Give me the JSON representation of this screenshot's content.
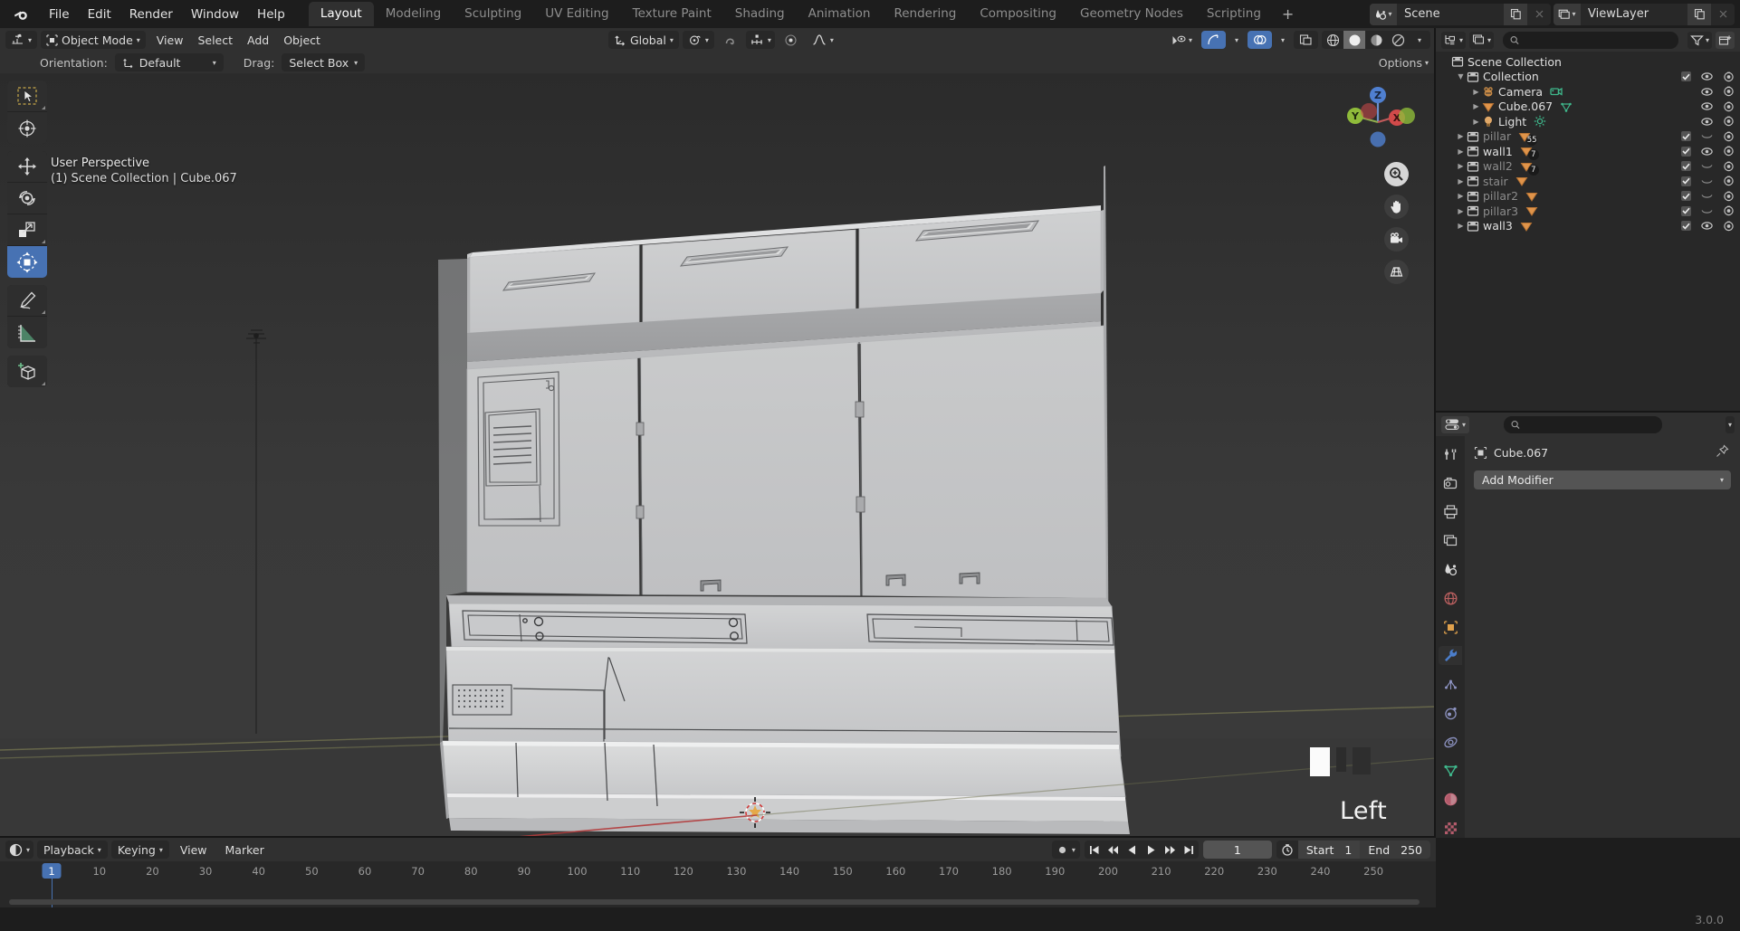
{
  "app": {
    "name": "Blender",
    "version": "3.0.0"
  },
  "topbar": {
    "menus": [
      "File",
      "Edit",
      "Render",
      "Window",
      "Help"
    ],
    "workspaces": [
      {
        "label": "Layout",
        "active": true
      },
      {
        "label": "Modeling",
        "active": false
      },
      {
        "label": "Sculpting",
        "active": false
      },
      {
        "label": "UV Editing",
        "active": false
      },
      {
        "label": "Texture Paint",
        "active": false
      },
      {
        "label": "Shading",
        "active": false
      },
      {
        "label": "Animation",
        "active": false
      },
      {
        "label": "Rendering",
        "active": false
      },
      {
        "label": "Compositing",
        "active": false
      },
      {
        "label": "Geometry Nodes",
        "active": false
      },
      {
        "label": "Scripting",
        "active": false
      }
    ],
    "add_workspace_label": "+",
    "scene_name": "Scene",
    "view_layer_name": "ViewLayer"
  },
  "viewport_header": {
    "mode": "Object Mode",
    "menus": [
      "View",
      "Select",
      "Add",
      "Object"
    ],
    "transform_orientation": "Global",
    "shading_modes": [
      "wireframe",
      "solid",
      "material-preview",
      "rendered"
    ],
    "active_shading_mode": "solid"
  },
  "tool_settings": {
    "orientation_label": "Orientation:",
    "orientation_value": "Default",
    "drag_label": "Drag:",
    "drag_value": "Select Box"
  },
  "viewport": {
    "perspective_text": "User Perspective",
    "context_text": "(1) Scene Collection | Cube.067",
    "view_label": "Left",
    "options_label": "Options",
    "tools": [
      {
        "name": "select-box-tool",
        "active": false
      },
      {
        "name": "cursor-tool",
        "active": false
      },
      {
        "name": "move-tool",
        "active": false
      },
      {
        "name": "rotate-tool",
        "active": false
      },
      {
        "name": "scale-tool",
        "active": false
      },
      {
        "name": "transform-tool",
        "active": true
      },
      {
        "name": "annotate-tool",
        "active": false
      },
      {
        "name": "measure-tool",
        "active": false
      },
      {
        "name": "add-cube-tool",
        "active": false
      }
    ],
    "gizmo_axes": [
      "Z",
      "Y",
      "X"
    ],
    "nav_buttons": [
      "zoom-icon",
      "pan-icon",
      "camera-icon",
      "ortho-grid-icon"
    ],
    "swatch_colors": [
      "#fbfbfb",
      "#2c2c2c",
      "#2e2e2e"
    ]
  },
  "outliner": {
    "search_placeholder": "",
    "rows": [
      {
        "label": "Scene Collection",
        "icon": "collection-icon",
        "indent": 0,
        "dim": false,
        "expander": "",
        "checkbox": false,
        "eye": false,
        "camera": false
      },
      {
        "label": "Collection",
        "icon": "collection-icon",
        "indent": 1,
        "dim": false,
        "expander": "down",
        "checkbox": true,
        "eye": true,
        "camera": true
      },
      {
        "label": "Camera",
        "icon": "camera-obj-icon",
        "indent": 2,
        "dim": false,
        "expander": "right",
        "checkbox": false,
        "eye": true,
        "camera": true,
        "data_icon": "camera-data-icon",
        "badge": ""
      },
      {
        "label": "Cube.067",
        "icon": "mesh-obj-icon",
        "indent": 2,
        "dim": false,
        "expander": "right",
        "checkbox": false,
        "eye": true,
        "camera": true,
        "data_icon": "mesh-data-icon",
        "badge": ""
      },
      {
        "label": "Light",
        "icon": "light-obj-icon",
        "indent": 2,
        "dim": false,
        "expander": "right",
        "checkbox": false,
        "eye": true,
        "camera": true,
        "data_icon": "light-data-icon",
        "badge": ""
      },
      {
        "label": "pillar",
        "icon": "collection-icon",
        "indent": 1,
        "dim": true,
        "expander": "right",
        "checkbox": true,
        "eye": false,
        "camera": true,
        "data_icon": "mesh-obj-icon",
        "badge": "55"
      },
      {
        "label": "wall1",
        "icon": "collection-icon",
        "indent": 1,
        "dim": false,
        "expander": "right",
        "checkbox": true,
        "eye": true,
        "camera": true,
        "data_icon": "mesh-obj-icon",
        "badge": "7"
      },
      {
        "label": "wall2",
        "icon": "collection-icon",
        "indent": 1,
        "dim": true,
        "expander": "right",
        "checkbox": true,
        "eye": false,
        "camera": true,
        "data_icon": "mesh-obj-icon",
        "badge": "7"
      },
      {
        "label": "stair",
        "icon": "collection-icon",
        "indent": 1,
        "dim": true,
        "expander": "right",
        "checkbox": true,
        "eye": false,
        "camera": true,
        "data_icon": "mesh-obj-icon",
        "badge": ""
      },
      {
        "label": "pillar2",
        "icon": "collection-icon",
        "indent": 1,
        "dim": true,
        "expander": "right",
        "checkbox": true,
        "eye": false,
        "camera": true,
        "data_icon": "mesh-obj-icon",
        "badge": ""
      },
      {
        "label": "pillar3",
        "icon": "collection-icon",
        "indent": 1,
        "dim": true,
        "expander": "right",
        "checkbox": true,
        "eye": false,
        "camera": true,
        "data_icon": "mesh-obj-icon",
        "badge": ""
      },
      {
        "label": "wall3",
        "icon": "collection-icon",
        "indent": 1,
        "dim": false,
        "expander": "right",
        "checkbox": true,
        "eye": true,
        "camera": true,
        "data_icon": "mesh-obj-icon",
        "badge": ""
      }
    ]
  },
  "properties": {
    "search_placeholder": "",
    "object_name": "Cube.067",
    "add_modifier_label": "Add Modifier",
    "tabs": [
      {
        "name": "tool-tab",
        "active": false
      },
      {
        "name": "render-tab",
        "active": false
      },
      {
        "name": "output-tab",
        "active": false
      },
      {
        "name": "view-layer-tab",
        "active": false
      },
      {
        "name": "scene-tab",
        "active": false
      },
      {
        "name": "world-tab",
        "active": false
      },
      {
        "name": "object-tab",
        "active": false
      },
      {
        "name": "modifier-tab",
        "active": true
      },
      {
        "name": "particles-tab",
        "active": false
      },
      {
        "name": "physics-tab",
        "active": false
      },
      {
        "name": "constraints-tab",
        "active": false
      },
      {
        "name": "object-data-tab",
        "active": false
      },
      {
        "name": "material-tab",
        "active": false
      },
      {
        "name": "texture-tab",
        "active": false
      }
    ]
  },
  "timeline": {
    "menus": [
      "Playback",
      "Keying",
      "View",
      "Marker"
    ],
    "current_frame": "1",
    "start_label": "Start",
    "start_value": "1",
    "end_label": "End",
    "end_value": "250",
    "ticks": [
      10,
      20,
      30,
      40,
      50,
      60,
      70,
      80,
      90,
      100,
      110,
      120,
      130,
      140,
      150,
      160,
      170,
      180,
      190,
      200,
      210,
      220,
      230,
      240,
      250
    ],
    "playhead_frame": 1,
    "transport_buttons": [
      "jump-to-start",
      "prev-keyframe",
      "play-reverse",
      "play",
      "next-keyframe",
      "jump-to-end"
    ]
  },
  "statusbar": {
    "version": "3.0.0"
  },
  "colors": {
    "accent_blue": "#4772b3",
    "panel_bg": "#303030",
    "editor_bg": "#282828",
    "window_bg": "#1d1d1d",
    "mesh_orange": "#e08a3c",
    "data_green": "#37b88b"
  }
}
